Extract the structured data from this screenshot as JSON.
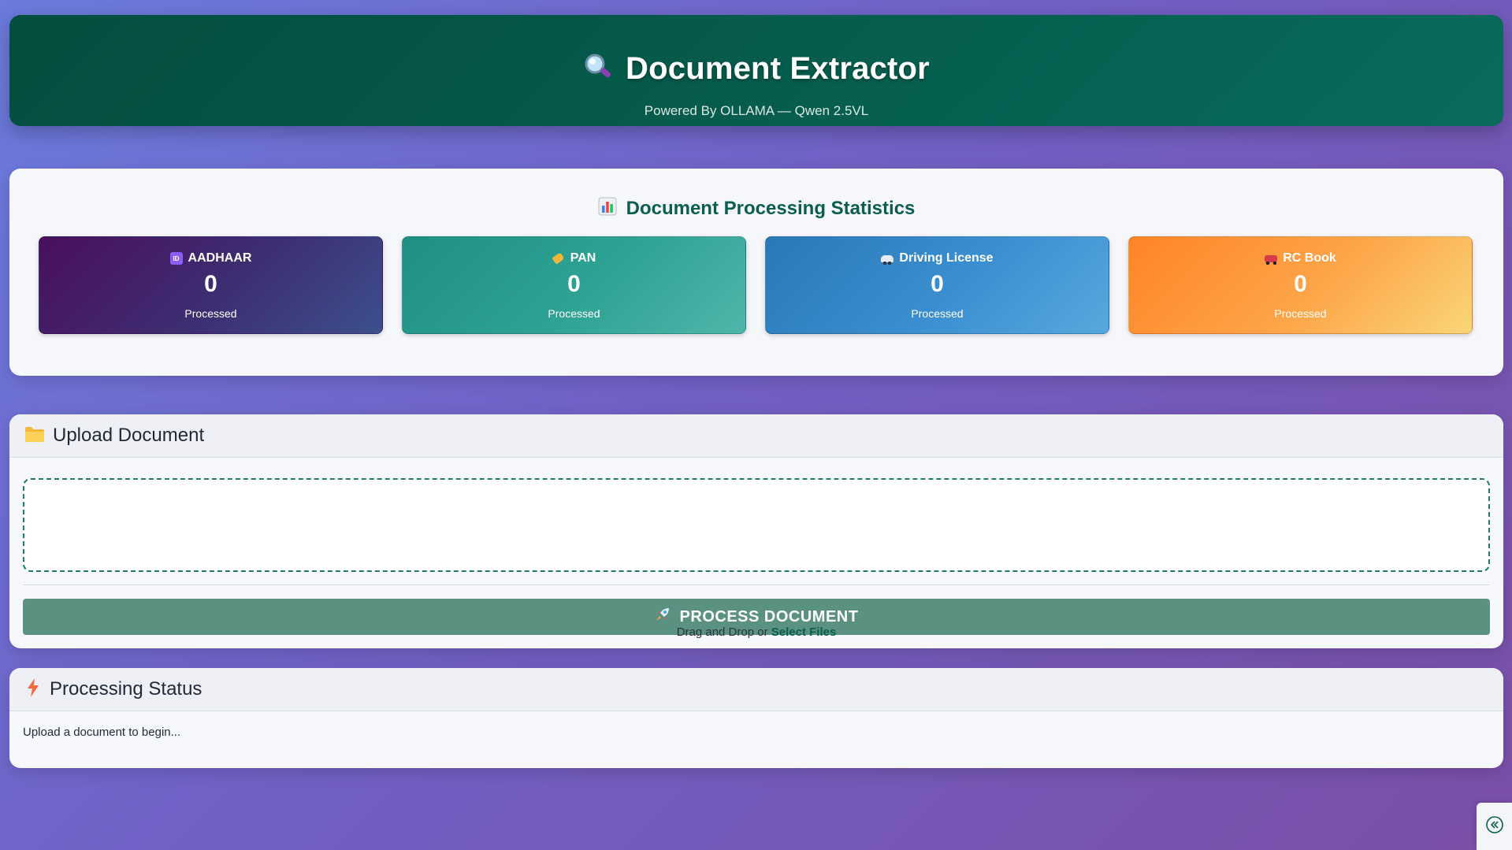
{
  "header": {
    "title": "Document Extractor",
    "subtitle": "Powered By OLLAMA — Qwen 2.5VL",
    "icon": "magnifier-icon"
  },
  "stats": {
    "title": "Document Processing Statistics",
    "icon": "bar-chart-icon",
    "cards": [
      {
        "label": "AADHAAR",
        "count": "0",
        "caption": "Processed",
        "icon": "id-icon"
      },
      {
        "label": "PAN",
        "count": "0",
        "caption": "Processed",
        "icon": "tag-icon"
      },
      {
        "label": "Driving License",
        "count": "0",
        "caption": "Processed",
        "icon": "car-icon"
      },
      {
        "label": "RC Book",
        "count": "0",
        "caption": "Processed",
        "icon": "truck-icon"
      }
    ]
  },
  "upload": {
    "title": "Upload Document",
    "icon": "folder-icon",
    "button_label": "PROCESS DOCUMENT",
    "button_icon": "rocket-icon",
    "drop_hint_prefix": "Drag and Drop or",
    "drop_hint_link": "Select Files"
  },
  "status": {
    "title": "Processing Status",
    "icon": "lightning-icon",
    "message": "Upload a document to begin..."
  },
  "colors": {
    "header_bg": "#065f4f",
    "accent": "#0b5e4f",
    "button_bg": "#5a9181"
  }
}
